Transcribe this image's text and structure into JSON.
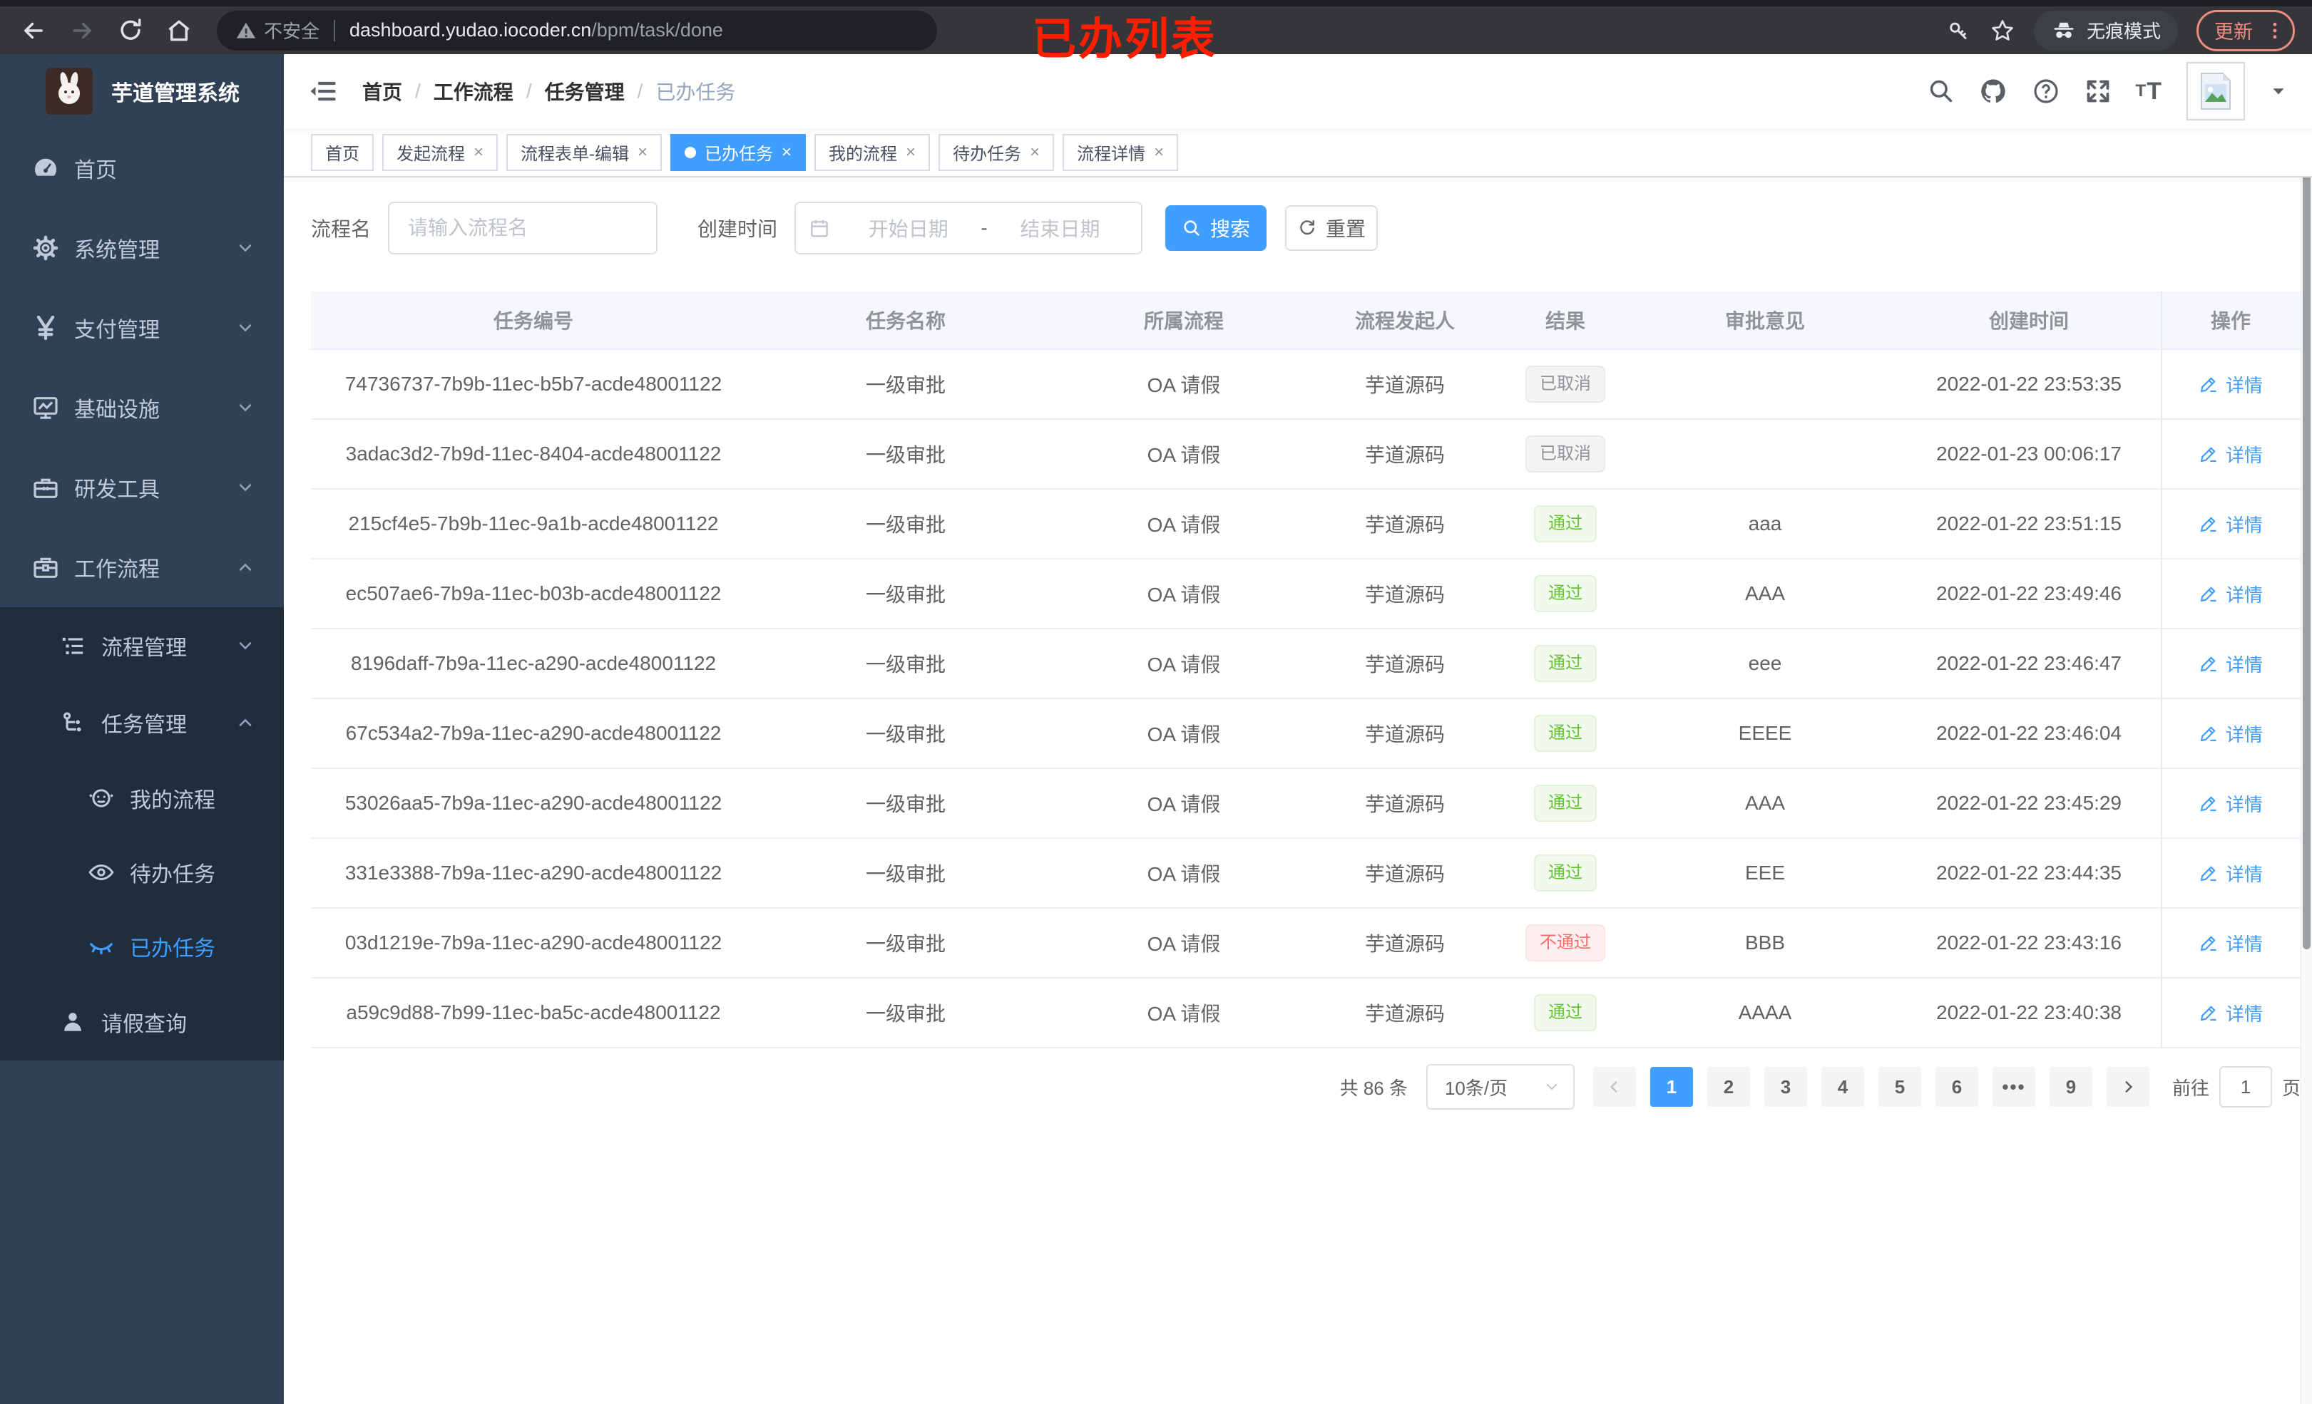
{
  "browser": {
    "security_label": "不安全",
    "url_domain": "dashboard.yudao.iocoder.cn",
    "url_path": "/bpm/task/done",
    "incognito_label": "无痕模式",
    "update_label": "更新",
    "annotation": "已办列表"
  },
  "sidebar": {
    "app_title": "芋道管理系统",
    "items": [
      {
        "label": "首页"
      },
      {
        "label": "系统管理"
      },
      {
        "label": "支付管理"
      },
      {
        "label": "基础设施"
      },
      {
        "label": "研发工具"
      },
      {
        "label": "工作流程"
      },
      {
        "label": "流程管理"
      },
      {
        "label": "任务管理"
      },
      {
        "label": "我的流程"
      },
      {
        "label": "待办任务"
      },
      {
        "label": "已办任务"
      },
      {
        "label": "请假查询"
      }
    ]
  },
  "breadcrumb": [
    "首页",
    "工作流程",
    "任务管理",
    "已办任务"
  ],
  "tabs": [
    {
      "label": "首页"
    },
    {
      "label": "发起流程"
    },
    {
      "label": "流程表单-编辑"
    },
    {
      "label": "已办任务"
    },
    {
      "label": "我的流程"
    },
    {
      "label": "待办任务"
    },
    {
      "label": "流程详情"
    }
  ],
  "filters": {
    "process_name_label": "流程名",
    "process_name_placeholder": "请输入流程名",
    "create_time_label": "创建时间",
    "date_start_placeholder": "开始日期",
    "date_separator": "-",
    "date_end_placeholder": "结束日期",
    "search_label": "搜索",
    "reset_label": "重置"
  },
  "table": {
    "columns": [
      "任务编号",
      "任务名称",
      "所属流程",
      "流程发起人",
      "结果",
      "审批意见",
      "创建时间",
      "操作"
    ],
    "action_label": "详情",
    "rows": [
      {
        "id": "74736737-7b9b-11ec-b5b7-acde48001122",
        "name": "一级审批",
        "process": "OA 请假",
        "initiator": "芋道源码",
        "result": "已取消",
        "opinion": "",
        "created": "2022-01-22 23:53:35"
      },
      {
        "id": "3adac3d2-7b9d-11ec-8404-acde48001122",
        "name": "一级审批",
        "process": "OA 请假",
        "initiator": "芋道源码",
        "result": "已取消",
        "opinion": "",
        "created": "2022-01-23 00:06:17"
      },
      {
        "id": "215cf4e5-7b9b-11ec-9a1b-acde48001122",
        "name": "一级审批",
        "process": "OA 请假",
        "initiator": "芋道源码",
        "result": "通过",
        "opinion": "aaa",
        "created": "2022-01-22 23:51:15"
      },
      {
        "id": "ec507ae6-7b9a-11ec-b03b-acde48001122",
        "name": "一级审批",
        "process": "OA 请假",
        "initiator": "芋道源码",
        "result": "通过",
        "opinion": "AAA",
        "created": "2022-01-22 23:49:46"
      },
      {
        "id": "8196daff-7b9a-11ec-a290-acde48001122",
        "name": "一级审批",
        "process": "OA 请假",
        "initiator": "芋道源码",
        "result": "通过",
        "opinion": "eee",
        "created": "2022-01-22 23:46:47"
      },
      {
        "id": "67c534a2-7b9a-11ec-a290-acde48001122",
        "name": "一级审批",
        "process": "OA 请假",
        "initiator": "芋道源码",
        "result": "通过",
        "opinion": "EEEE",
        "created": "2022-01-22 23:46:04"
      },
      {
        "id": "53026aa5-7b9a-11ec-a290-acde48001122",
        "name": "一级审批",
        "process": "OA 请假",
        "initiator": "芋道源码",
        "result": "通过",
        "opinion": "AAA",
        "created": "2022-01-22 23:45:29"
      },
      {
        "id": "331e3388-7b9a-11ec-a290-acde48001122",
        "name": "一级审批",
        "process": "OA 请假",
        "initiator": "芋道源码",
        "result": "通过",
        "opinion": "EEE",
        "created": "2022-01-22 23:44:35"
      },
      {
        "id": "03d1219e-7b9a-11ec-a290-acde48001122",
        "name": "一级审批",
        "process": "OA 请假",
        "initiator": "芋道源码",
        "result": "不通过",
        "opinion": "BBB",
        "created": "2022-01-22 23:43:16"
      },
      {
        "id": "a59c9d88-7b99-11ec-ba5c-acde48001122",
        "name": "一级审批",
        "process": "OA 请假",
        "initiator": "芋道源码",
        "result": "通过",
        "opinion": "AAAA",
        "created": "2022-01-22 23:40:38"
      }
    ]
  },
  "pagination": {
    "total_label": "共 86 条",
    "page_size_label": "10条/页",
    "pages": [
      "1",
      "2",
      "3",
      "4",
      "5",
      "6",
      "•••",
      "9"
    ],
    "active_page": "1",
    "goto_label": "前往",
    "goto_value": "1",
    "page_suffix": "页"
  },
  "colors": {
    "accent": "#409eff",
    "success": "#67c23a",
    "danger": "#f56c6c",
    "info": "#909399",
    "sidebar_bg": "#304156",
    "submenu_bg": "#1f2d3d",
    "annotation": "#ff1e00"
  }
}
